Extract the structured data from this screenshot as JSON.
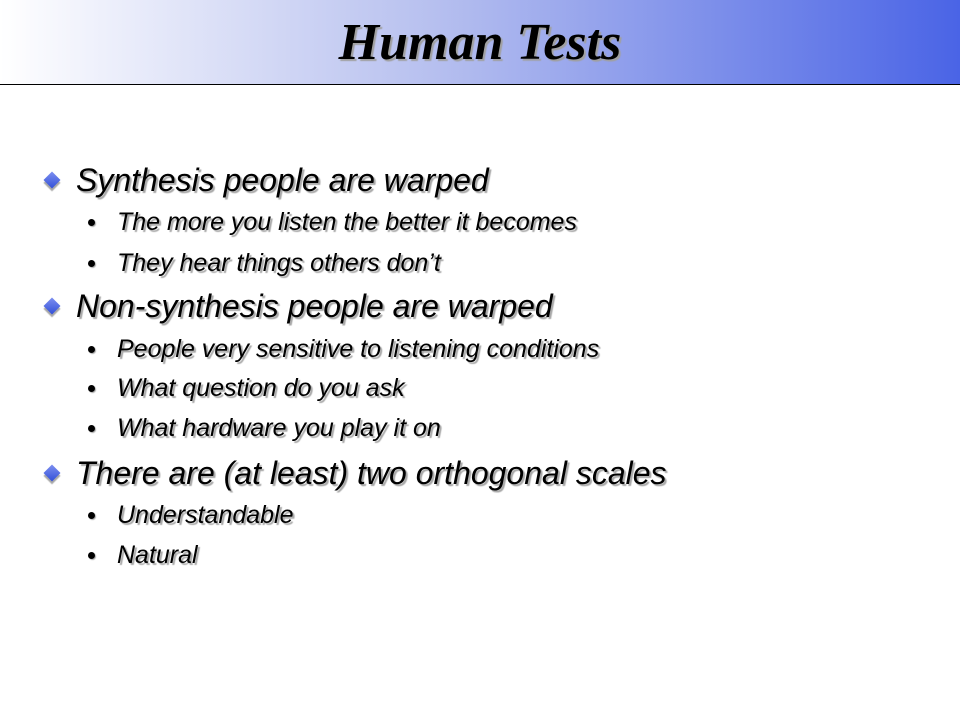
{
  "slide": {
    "title": "Human Tests",
    "accent_color": "#4a64e6",
    "bullets": [
      {
        "text": "Synthesis people are warped",
        "subitems": [
          "The more you listen the better it becomes",
          "They hear things others don’t"
        ]
      },
      {
        "text": "Non-synthesis people are warped",
        "subitems": [
          "People very sensitive to listening conditions",
          "What question do you ask",
          "What hardware you play it on"
        ]
      },
      {
        "text": "There are (at least) two orthogonal scales",
        "subitems": [
          "Understandable",
          "Natural"
        ]
      }
    ]
  },
  "icons": {
    "level1": "diamond-bullet-icon",
    "level2": "round-bullet-icon"
  }
}
